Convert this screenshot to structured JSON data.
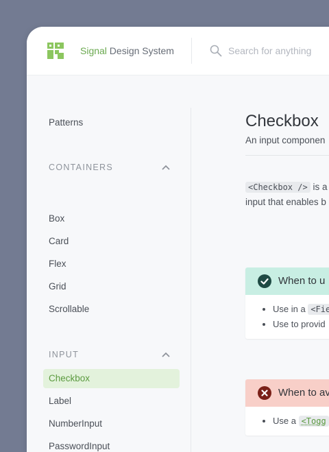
{
  "header": {
    "brand_accent": "Signal",
    "brand_rest": " Design System",
    "search_placeholder": "Search for anything"
  },
  "sidebar": {
    "top_items": [
      {
        "label": "Patterns"
      }
    ],
    "sections": [
      {
        "title": "CONTAINERS",
        "expanded": true,
        "items": [
          {
            "label": "Box"
          },
          {
            "label": "Card"
          },
          {
            "label": "Flex"
          },
          {
            "label": "Grid"
          },
          {
            "label": "Scrollable"
          }
        ]
      },
      {
        "title": "INPUT",
        "expanded": true,
        "items": [
          {
            "label": "Checkbox",
            "selected": true
          },
          {
            "label": "Label"
          },
          {
            "label": "NumberInput"
          },
          {
            "label": "PasswordInput"
          }
        ]
      }
    ]
  },
  "main": {
    "title": "Checkbox",
    "subtitle": "An input componen",
    "intro_code": "<Checkbox />",
    "intro_text_1": " is a",
    "intro_text_2": "input that enables b",
    "do_card": {
      "heading": "When to u",
      "items": [
        {
          "text": "Use in a ",
          "code": "<Fie"
        },
        {
          "text": "Use to provid",
          "code": ""
        }
      ]
    },
    "dont_card": {
      "heading": "When to av",
      "items": [
        {
          "text": "Use a ",
          "code": "<Togg"
        }
      ]
    }
  },
  "colors": {
    "background": "#737b92",
    "brand_green": "#6aa84f",
    "selected_bg": "#e3f2dc",
    "do_bg": "#c8eee3",
    "dont_bg": "#f8cfc8",
    "do_icon": "#1f4a44",
    "dont_icon": "#7a2018"
  },
  "icons": {
    "logo": "signal-logo-icon",
    "search": "search-icon",
    "section_toggle": "chevron-up-icon",
    "do": "check-circle-icon",
    "dont": "x-circle-icon"
  }
}
